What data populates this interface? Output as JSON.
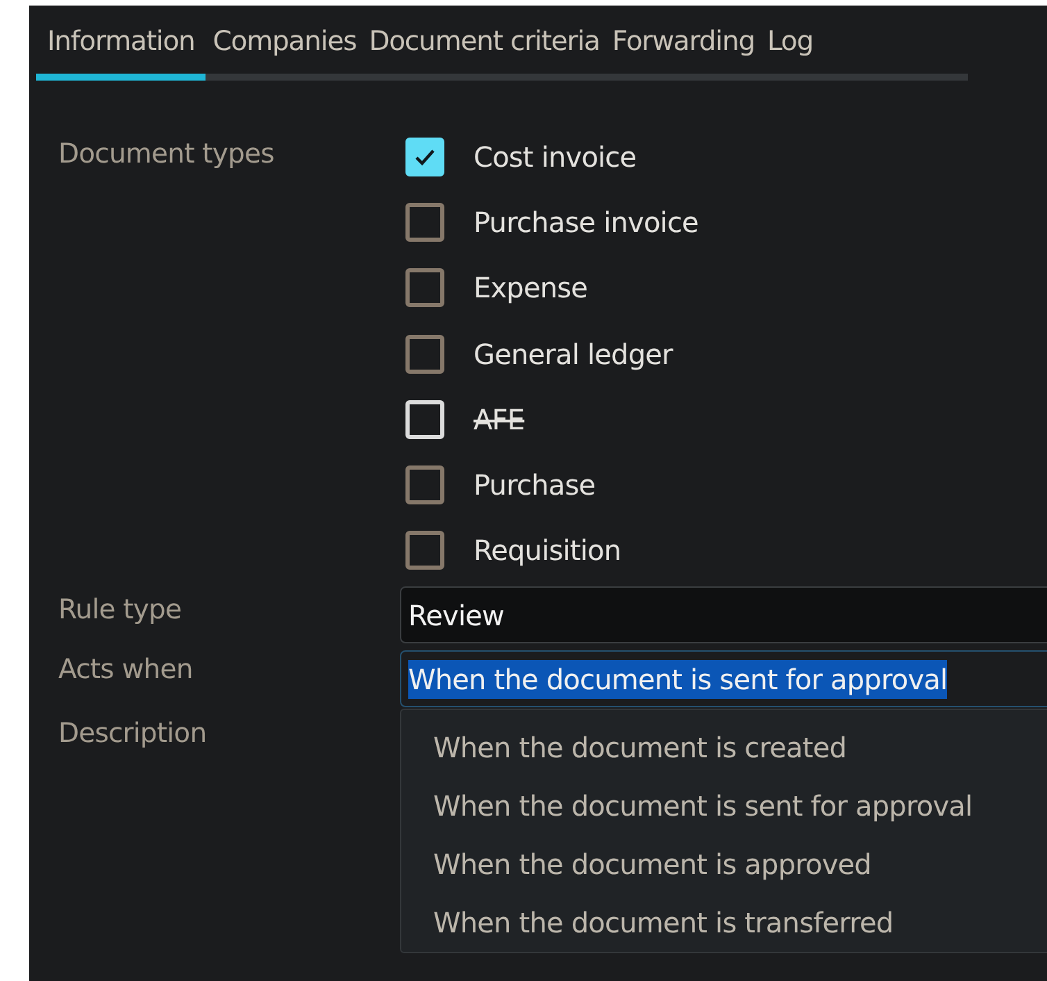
{
  "tabs": [
    {
      "label": "Information",
      "selected": true
    },
    {
      "label": "Companies",
      "selected": false
    },
    {
      "label": "Document criteria",
      "selected": false
    },
    {
      "label": "Forwarding",
      "selected": false
    },
    {
      "label": "Log",
      "selected": false
    }
  ],
  "document_types": {
    "label": "Document types",
    "options": [
      {
        "label": "Cost invoice",
        "checked": true,
        "struck": false,
        "hovered": false
      },
      {
        "label": "Purchase invoice",
        "checked": false,
        "struck": false,
        "hovered": false
      },
      {
        "label": "Expense",
        "checked": false,
        "struck": false,
        "hovered": false
      },
      {
        "label": "General ledger",
        "checked": false,
        "struck": false,
        "hovered": false
      },
      {
        "label": "AFE",
        "checked": false,
        "struck": true,
        "hovered": true
      },
      {
        "label": "Purchase",
        "checked": false,
        "struck": false,
        "hovered": false
      },
      {
        "label": "Requisition",
        "checked": false,
        "struck": false,
        "hovered": false
      }
    ]
  },
  "rule_type": {
    "label": "Rule type",
    "value": "Review"
  },
  "acts_when": {
    "label": "Acts when",
    "value": "When the document is sent for approval",
    "focused": true,
    "text_selected": true,
    "expanded": true,
    "options": [
      {
        "label": "When the document is created"
      },
      {
        "label": "When the document is sent for approval"
      },
      {
        "label": "When the document is approved"
      },
      {
        "label": "When the document is transferred"
      }
    ]
  },
  "description": {
    "label": "Description"
  }
}
